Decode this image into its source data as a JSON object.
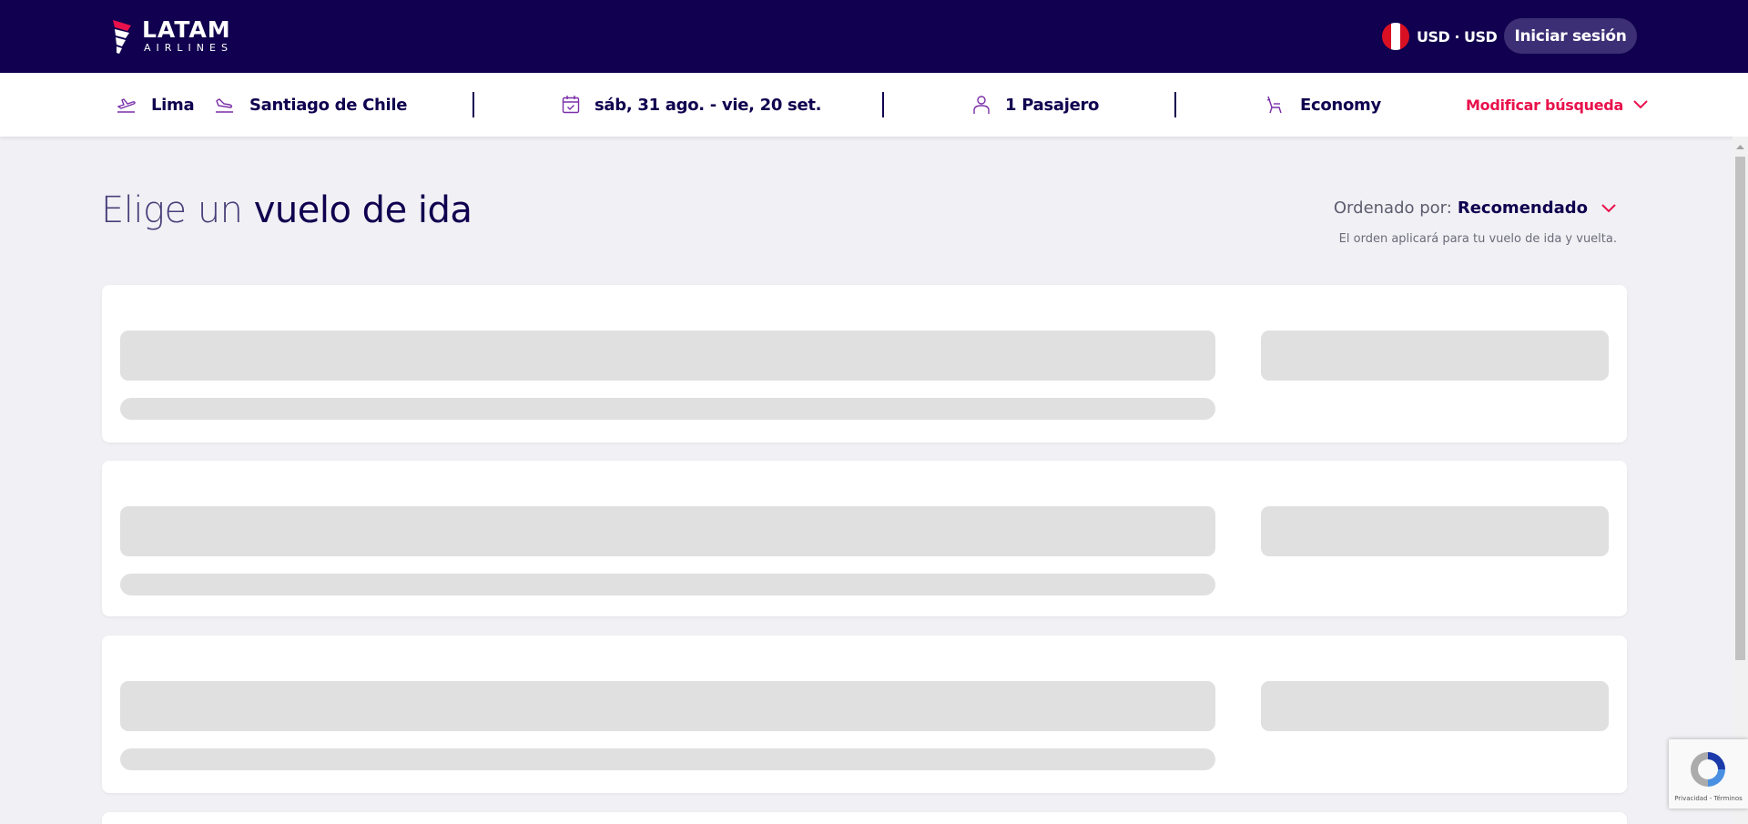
{
  "header": {
    "logo_main": "LATAM",
    "logo_sub": "AIRLINES",
    "currency_label": "USD · USD",
    "login_label": "Iniciar sesión"
  },
  "search_summary": {
    "origin": "Lima",
    "destination": "Santiago de Chile",
    "dates": "sáb, 31 ago. - vie, 20 set.",
    "passengers": "1 Pasajero",
    "cabin": "Economy",
    "modify_label": "Modificar búsqueda"
  },
  "main": {
    "title_prefix": "Elige un",
    "title_main": "vuelo de ida",
    "sort_prefix": "Ordenado por:",
    "sort_value": "Recomendado",
    "sort_note": "El orden aplicará para tu vuelo de ida y vuelta."
  },
  "recaptcha": {
    "links": "Privacidad - Términos"
  },
  "colors": {
    "brand_navy": "#10004f",
    "accent_red": "#e8114b",
    "login_button_bg": "#3c2f75",
    "page_bg": "#f1f1f5",
    "skeleton": "#e0e0e0"
  },
  "icons": {
    "origin": "takeoff-icon",
    "destination": "landing-icon",
    "dates": "calendar-icon",
    "passengers": "person-icon",
    "cabin": "seat-icon",
    "modify": "chevron-down-icon",
    "sort": "chevron-down-icon"
  }
}
